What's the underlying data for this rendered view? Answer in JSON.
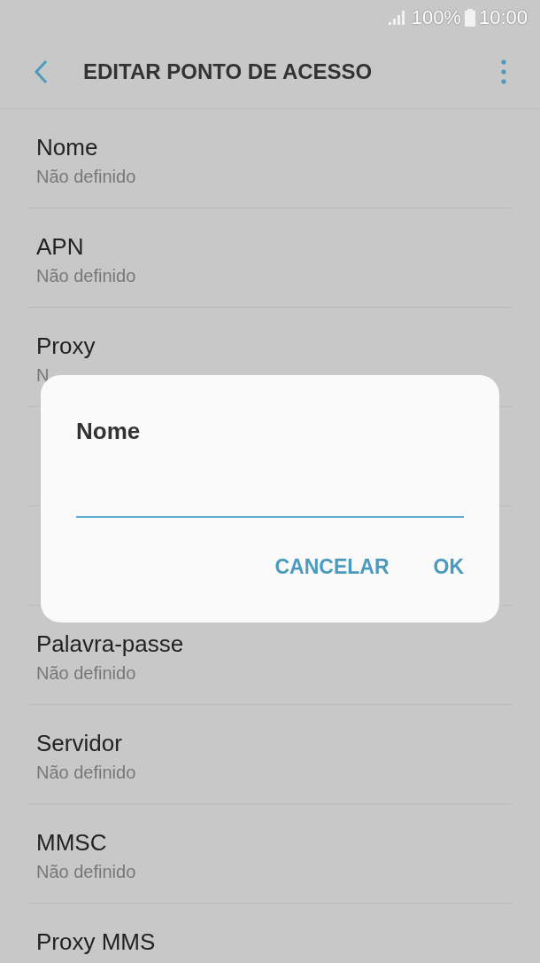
{
  "status_bar": {
    "battery": "100%",
    "time": "10:00"
  },
  "header": {
    "title": "EDITAR PONTO DE ACESSO"
  },
  "items": [
    {
      "kind": "row",
      "title": "Nome",
      "value": "Não definido"
    },
    {
      "kind": "row",
      "title": "APN",
      "value": "Não definido"
    },
    {
      "kind": "row",
      "title": "Proxy",
      "value": "N"
    },
    {
      "kind": "covered"
    },
    {
      "kind": "covered"
    },
    {
      "kind": "row",
      "title": "Palavra-passe",
      "value": "Não definido"
    },
    {
      "kind": "row",
      "title": "Servidor",
      "value": "Não definido"
    },
    {
      "kind": "row",
      "title": "MMSC",
      "value": "Não definido"
    },
    {
      "kind": "row",
      "title": "Proxy MMS"
    }
  ],
  "dialog": {
    "title": "Nome",
    "input_focused": true,
    "buttons": [
      "CANCELAR",
      "OK"
    ]
  }
}
